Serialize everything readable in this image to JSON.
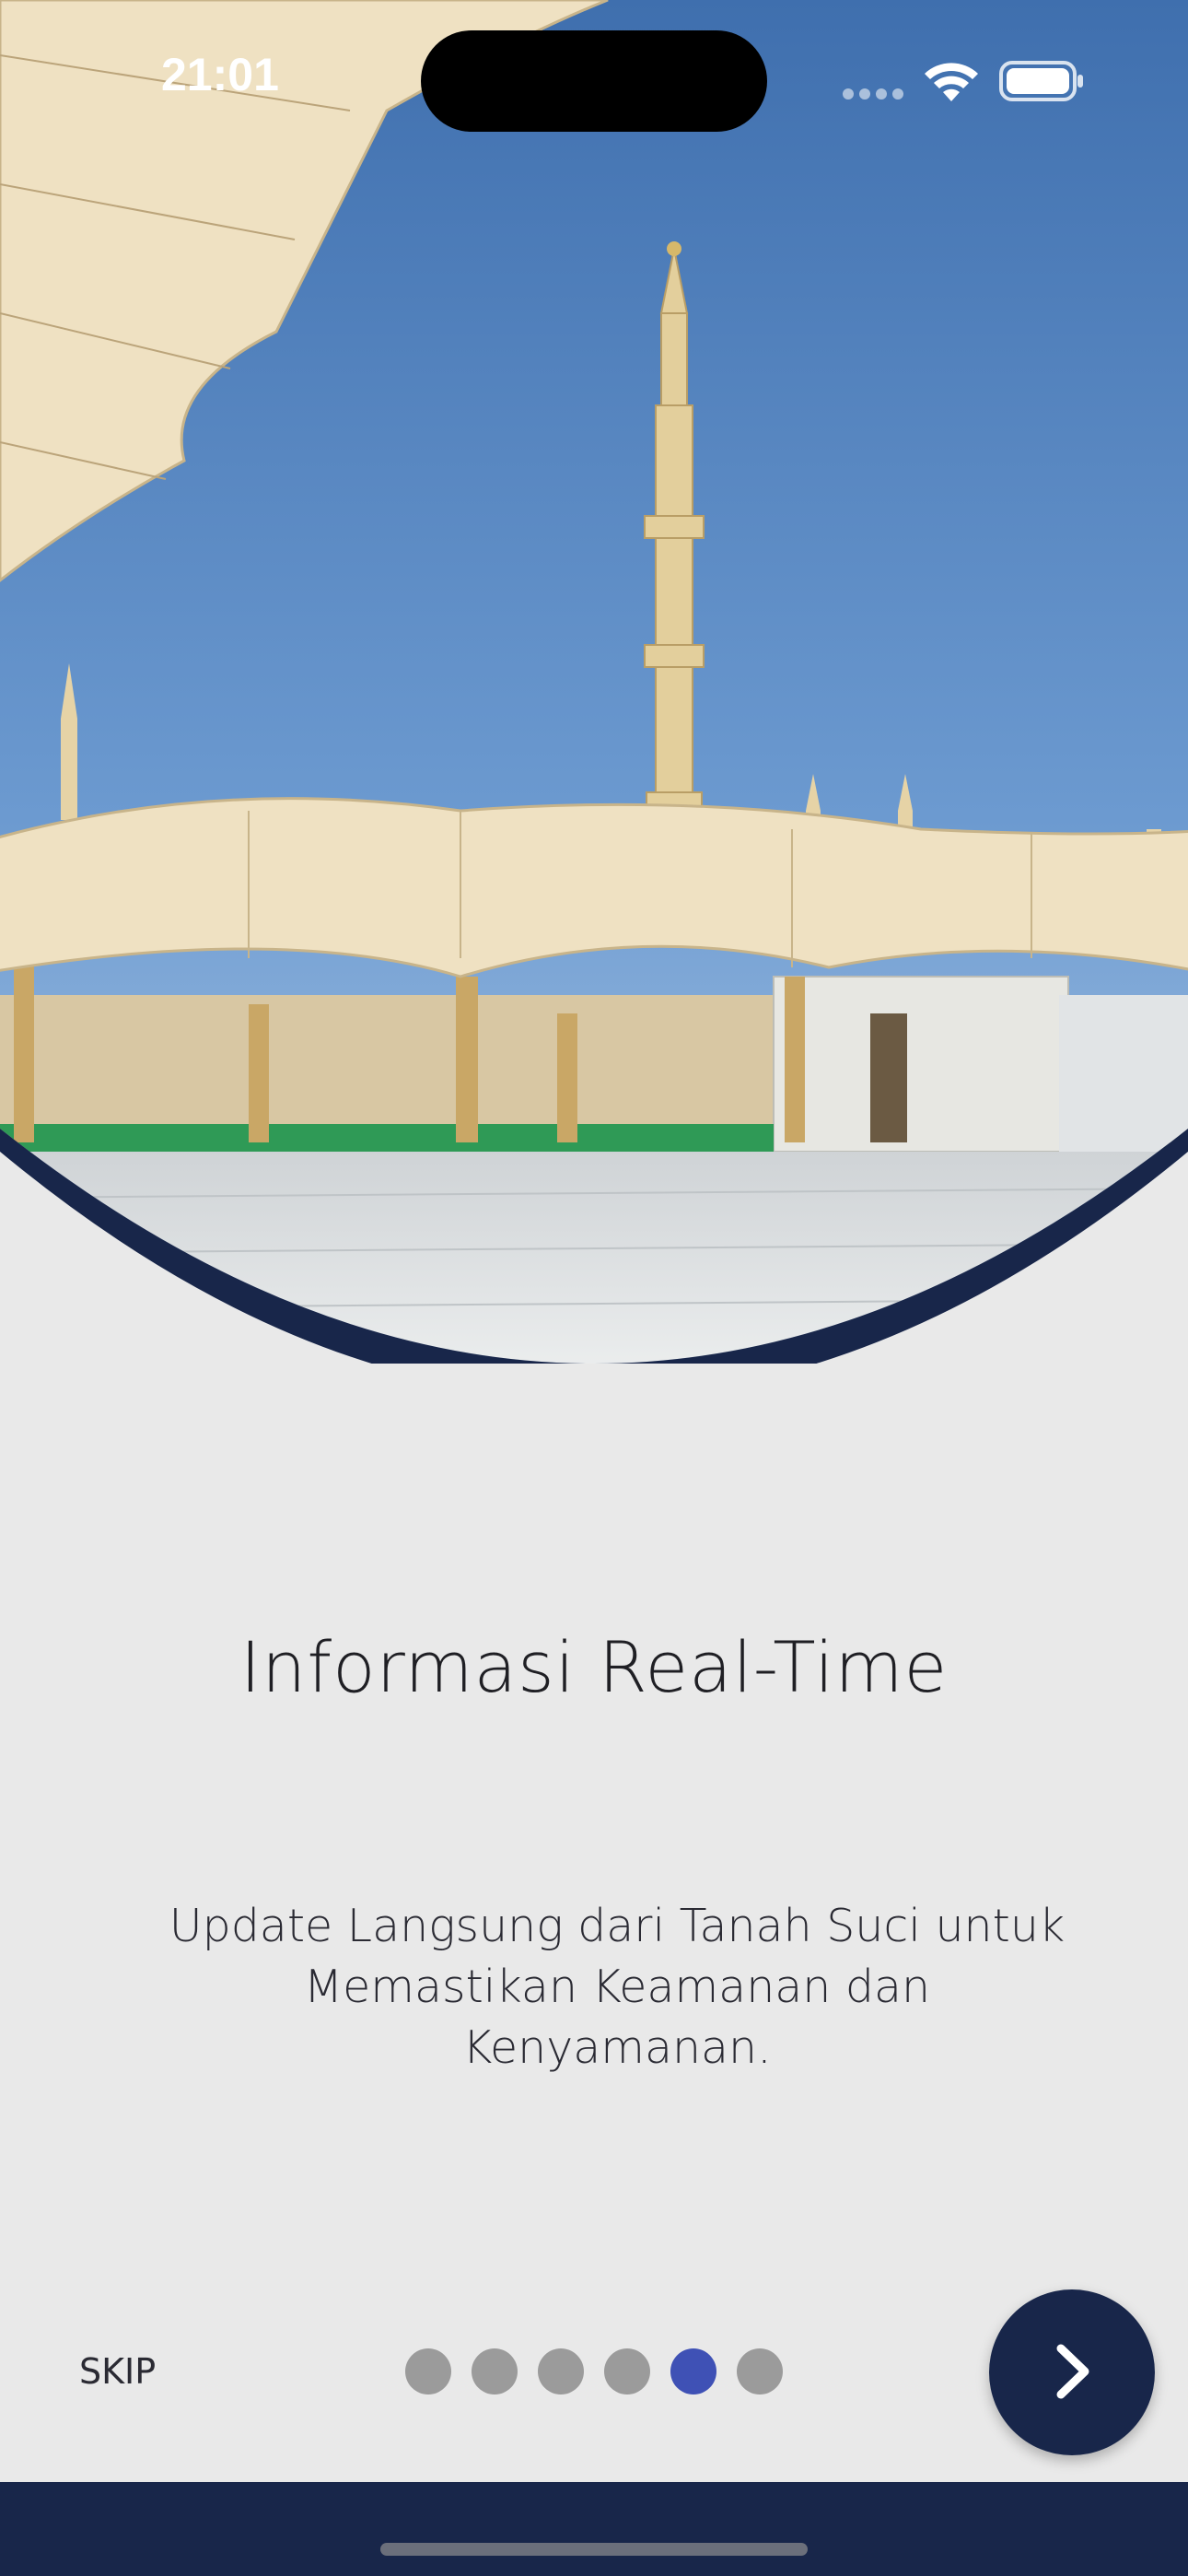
{
  "status_bar": {
    "time": "21:01"
  },
  "hero": {
    "image": "mosque-courtyard-with-umbrellas-and-minaret",
    "accent_curve_color": "#18264a"
  },
  "onboarding": {
    "title": "Informasi Real-Time",
    "description_line1": "Update Langsung dari Tanah Suci untuk",
    "description_line2": "Memastikan Keamanan dan Kenyamanan.",
    "pagination": {
      "total": 6,
      "active_index": 5
    }
  },
  "controls": {
    "skip_label": "SKIP",
    "next_icon": "chevron-right-icon"
  },
  "colors": {
    "background": "#e9e9e9",
    "navy": "#18264a",
    "dot_active": "#3f51b5",
    "dot_inactive": "#9b9b9b"
  }
}
